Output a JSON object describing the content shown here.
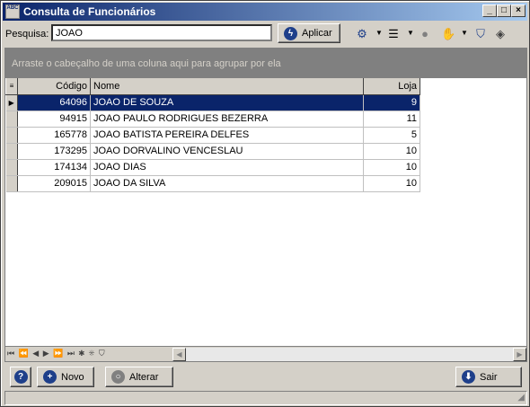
{
  "window": {
    "title": "Consulta de Funcionários",
    "icon_text": "ABC",
    "minimize_icon": "minimize-icon",
    "maximize_icon": "maximize-icon",
    "close_icon": "close-icon"
  },
  "search": {
    "label": "Pesquisa:",
    "value": "JOAO",
    "apply_label": "Aplicar"
  },
  "grid": {
    "group_hint": "Arraste o cabeçalho de uma coluna aqui para agrupar por ela",
    "columns": [
      "Código",
      "Nome",
      "Loja"
    ],
    "rows": [
      {
        "codigo": "64096",
        "nome": "JOAO DE SOUZA",
        "loja": "9"
      },
      {
        "codigo": "94915",
        "nome": "JOAO PAULO RODRIGUES BEZERRA",
        "loja": "11"
      },
      {
        "codigo": "165778",
        "nome": "JOAO BATISTA PEREIRA DELFES",
        "loja": "5"
      },
      {
        "codigo": "173295",
        "nome": "JOAO DORVALINO VENCESLAU",
        "loja": "10"
      },
      {
        "codigo": "174134",
        "nome": "JOAO DIAS",
        "loja": "10"
      },
      {
        "codigo": "209015",
        "nome": "JOAO DA SILVA",
        "loja": "10"
      }
    ],
    "selected_row": 0
  },
  "footer": {
    "novo_label": "Novo",
    "alterar_label": "Alterar",
    "sair_label": "Sair"
  },
  "colors": {
    "title_start": "#0a246a",
    "title_end": "#a6caf0",
    "selection": "#0a246a",
    "group_bar": "#808080"
  }
}
